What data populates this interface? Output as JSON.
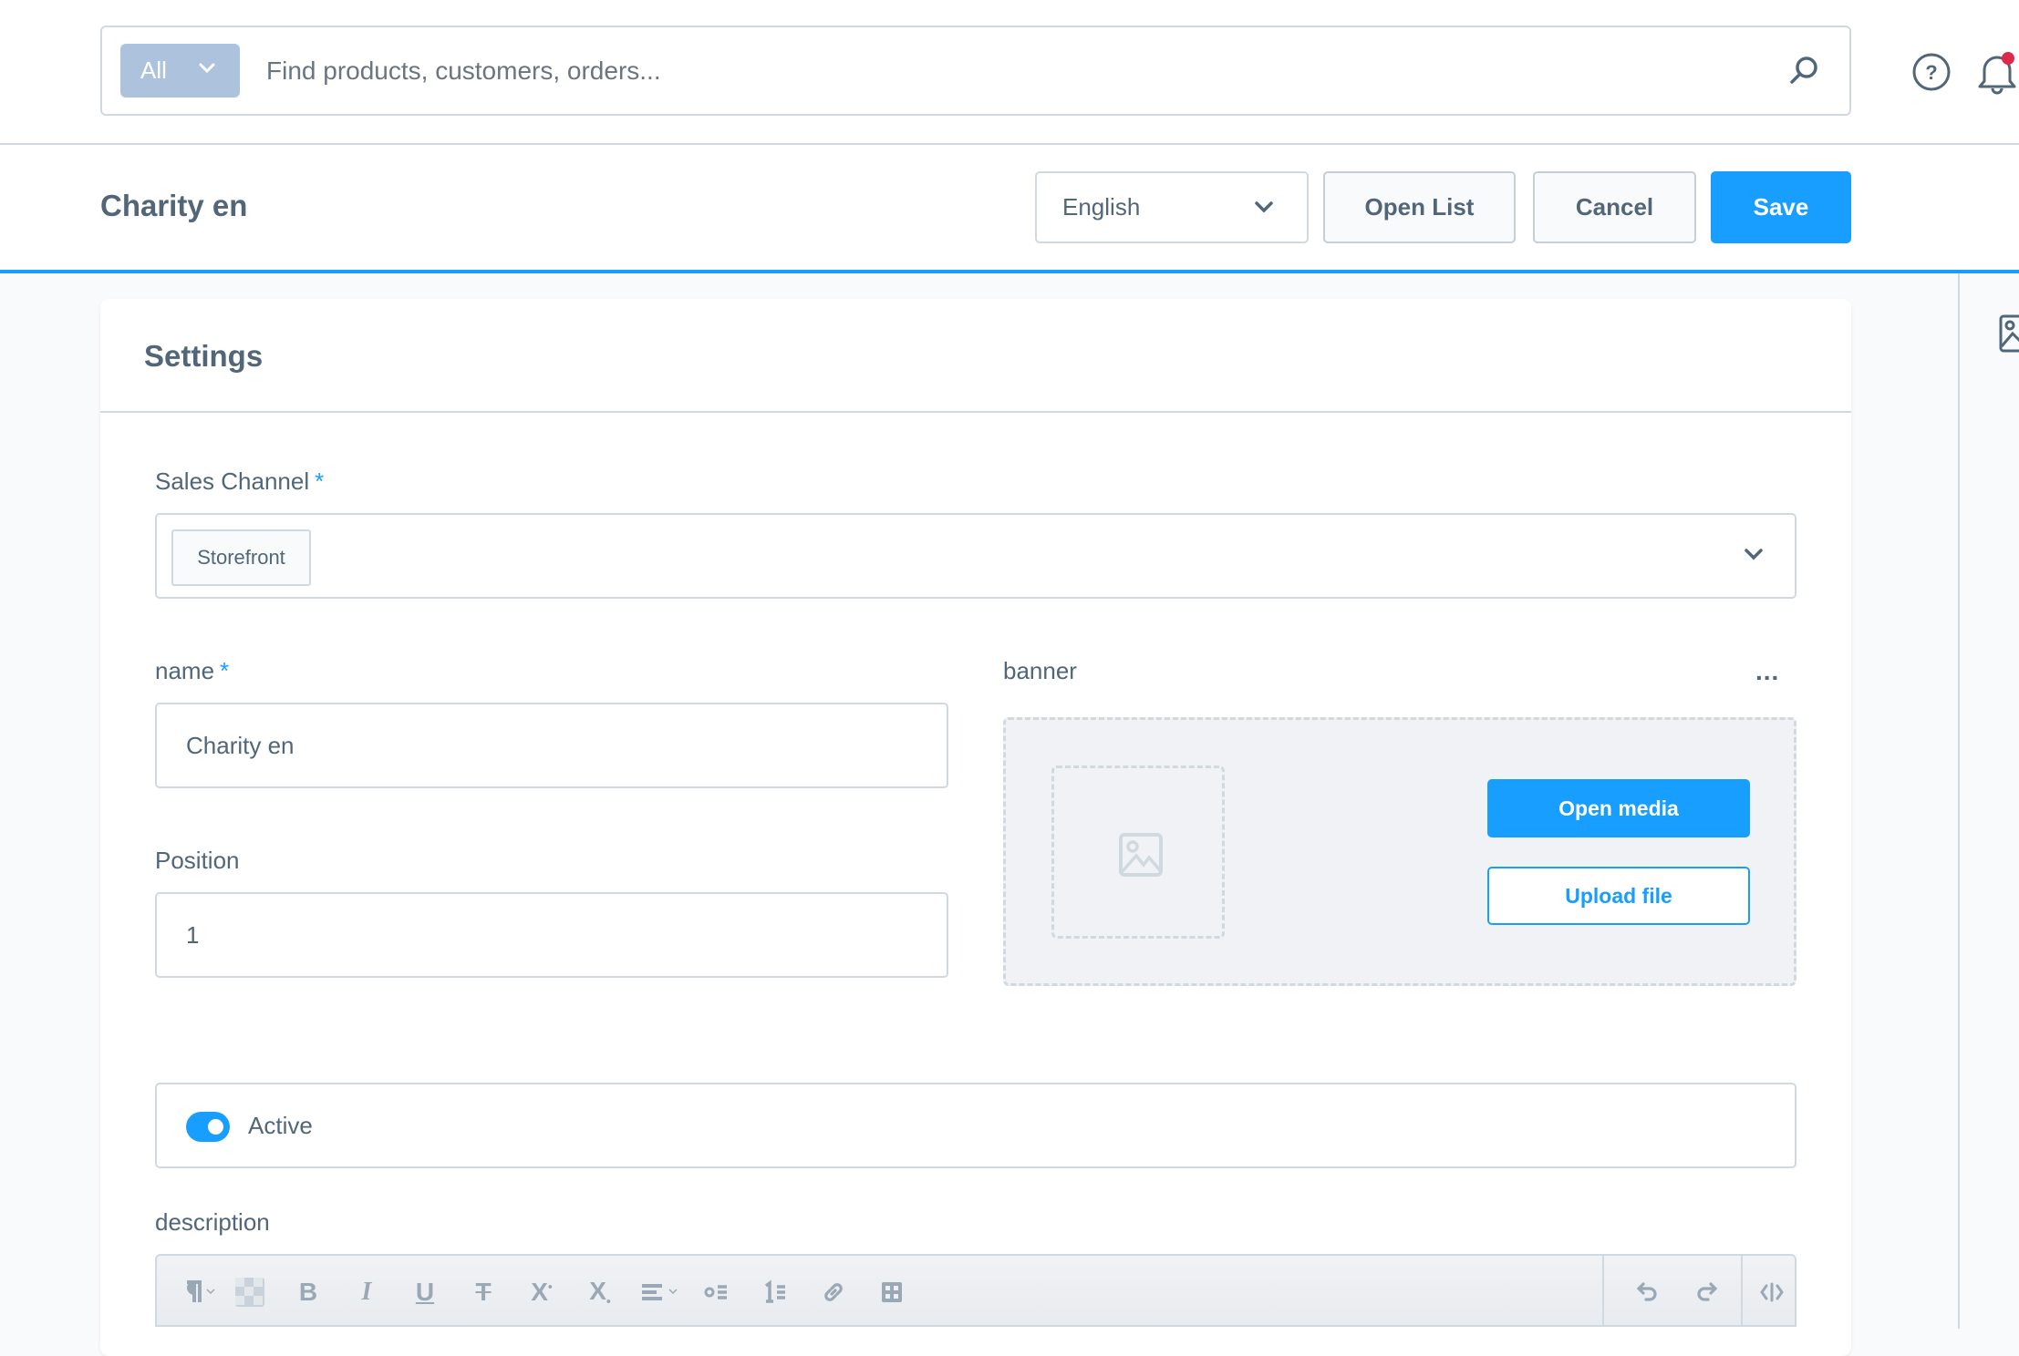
{
  "topbar": {
    "search_type": "All",
    "search_placeholder": "Find products, customers, orders...",
    "search_value": "",
    "notification_dot_color": "#de294c"
  },
  "header": {
    "title": "Charity en",
    "language": "English",
    "open_list_label": "Open List",
    "cancel_label": "Cancel",
    "save_label": "Save",
    "accent_color": "#189eff"
  },
  "card": {
    "title": "Settings",
    "sales_channel": {
      "label": "Sales Channel",
      "required_mark": "*",
      "selected": [
        "Storefront"
      ]
    },
    "name": {
      "label": "name",
      "required_mark": "*",
      "value": "Charity en"
    },
    "position": {
      "label": "Position",
      "value": "1"
    },
    "banner": {
      "label": "banner",
      "more_label": "...",
      "open_media_label": "Open media",
      "upload_label": "Upload file"
    },
    "active": {
      "label": "Active",
      "checked": true
    },
    "description": {
      "label": "description",
      "toolbar": [
        "paragraph-format",
        "text-color",
        "bold",
        "italic",
        "underline",
        "strikethrough",
        "superscript",
        "subscript",
        "text-align",
        "unordered-list",
        "ordered-list",
        "link",
        "table",
        "undo",
        "redo",
        "code-view"
      ]
    }
  }
}
